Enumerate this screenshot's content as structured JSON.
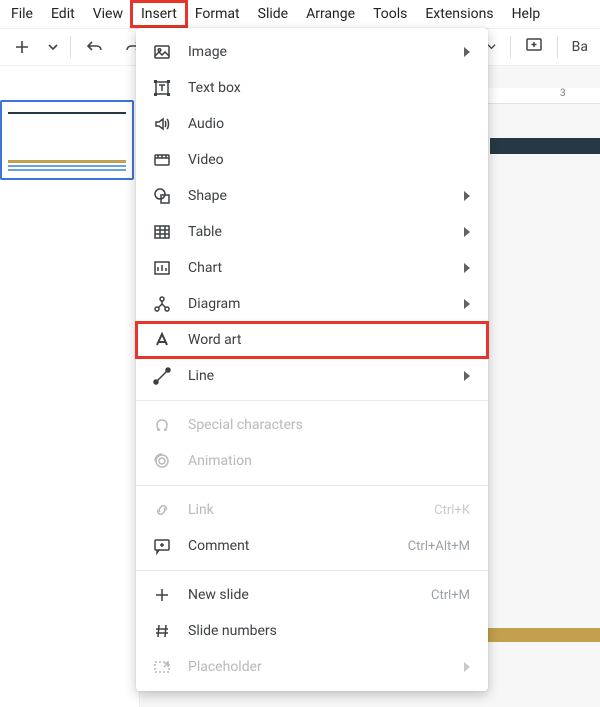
{
  "menubar": {
    "items": [
      "File",
      "Edit",
      "View",
      "Insert",
      "Format",
      "Slide",
      "Arrange",
      "Tools",
      "Extensions",
      "Help"
    ],
    "active_index": 3
  },
  "toolbar": {
    "right_label": "Ba"
  },
  "ruler": {
    "label_3": "3"
  },
  "dropdown": {
    "highlight_index": 10,
    "items": [
      {
        "label": "Image",
        "icon": "image-icon",
        "submenu": true
      },
      {
        "label": "Text box",
        "icon": "textbox-icon"
      },
      {
        "label": "Audio",
        "icon": "audio-icon"
      },
      {
        "label": "Video",
        "icon": "video-icon"
      },
      {
        "label": "Shape",
        "icon": "shape-icon",
        "submenu": true
      },
      {
        "label": "Table",
        "icon": "table-icon",
        "submenu": true
      },
      {
        "label": "Chart",
        "icon": "chart-icon",
        "submenu": true
      },
      {
        "label": "Diagram",
        "icon": "diagram-icon",
        "submenu": true
      },
      {
        "label": "Word art",
        "icon": "wordart-icon"
      },
      {
        "label": "Line",
        "icon": "line-icon",
        "submenu": true
      },
      {
        "label": "Special characters",
        "icon": "omega-icon",
        "disabled": true
      },
      {
        "label": "Animation",
        "icon": "animation-icon",
        "disabled": true
      },
      {
        "label": "Link",
        "icon": "link-icon",
        "shortcut": "Ctrl+K",
        "disabled": true
      },
      {
        "label": "Comment",
        "icon": "comment-icon",
        "shortcut": "Ctrl+Alt+M"
      },
      {
        "label": "New slide",
        "icon": "plus-icon",
        "shortcut": "Ctrl+M"
      },
      {
        "label": "Slide numbers",
        "icon": "hash-icon"
      },
      {
        "label": "Placeholder",
        "icon": "placeholder-icon",
        "submenu": true,
        "disabled": true
      }
    ]
  }
}
